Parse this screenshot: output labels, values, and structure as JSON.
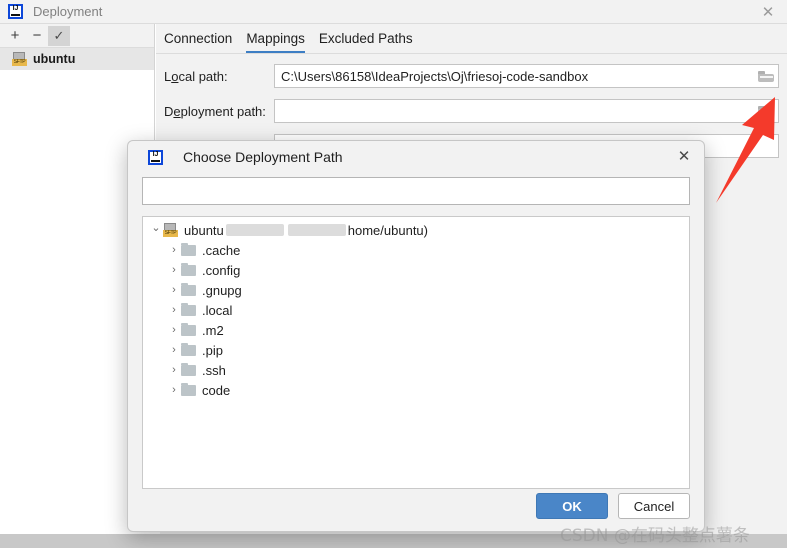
{
  "window": {
    "title": "Deployment",
    "logo_icon": "intellij-idea-icon",
    "close_icon": "close-icon"
  },
  "sidebar": {
    "toolbar": [
      {
        "name": "add",
        "glyph": "+",
        "checked": false
      },
      {
        "name": "remove",
        "glyph": "−",
        "checked": false
      },
      {
        "name": "set-default",
        "glyph": "✓",
        "checked": true
      }
    ],
    "servers": [
      {
        "label": "ubuntu",
        "icon": "sftp-server-icon",
        "badge": "SFTP",
        "selected": true
      }
    ]
  },
  "tabs": [
    {
      "label": "Connection",
      "active": false
    },
    {
      "label": "Mappings",
      "active": true
    },
    {
      "label": "Excluded Paths",
      "active": false
    }
  ],
  "fields": {
    "local_path": {
      "label_pre": "L",
      "label_mnemonic": "o",
      "label_post": "cal path:",
      "label": "Local path:",
      "value": "C:\\Users\\86158\\IdeaProjects\\Oj\\friesoj-code-sandbox",
      "browse_icon": "folder-browse-icon"
    },
    "deployment_path": {
      "label_pre": "D",
      "label_mnemonic": "e",
      "label_post": "ployment path:",
      "label": "Deployment path:",
      "value": "",
      "browse_icon": "folder-browse-icon"
    }
  },
  "background_hint": "u),",
  "dialog": {
    "logo_icon": "intellij-idea-icon",
    "title": "Choose Deployment Path",
    "close_icon": "close-icon",
    "search_value": "",
    "tree": {
      "root": {
        "label": "ubuntu",
        "icon": "sftp-server-icon",
        "badge": "SFTP",
        "redacted": true,
        "suffix": "home/ubuntu)",
        "expanded": true
      },
      "children": [
        {
          "label": ".cache",
          "icon": "folder-icon",
          "expanded": false
        },
        {
          "label": ".config",
          "icon": "folder-icon",
          "expanded": false
        },
        {
          "label": ".gnupg",
          "icon": "folder-icon",
          "expanded": false
        },
        {
          "label": ".local",
          "icon": "folder-icon",
          "expanded": false
        },
        {
          "label": ".m2",
          "icon": "folder-icon",
          "expanded": false
        },
        {
          "label": ".pip",
          "icon": "folder-icon",
          "expanded": false
        },
        {
          "label": ".ssh",
          "icon": "folder-icon",
          "expanded": false
        },
        {
          "label": "code",
          "icon": "folder-icon",
          "expanded": false
        }
      ]
    },
    "buttons": {
      "ok": "OK",
      "cancel": "Cancel"
    }
  },
  "annotation": {
    "arrow_icon": "red-arrow-annotation",
    "color": "#f43a2b"
  },
  "watermark": "CSDN @在码头整点薯条",
  "colors": {
    "accent_blue": "#3d7ec4",
    "primary_button": "#4a86c8",
    "panel_bg": "#f2f2f2",
    "selection_bg": "#e6e6e6",
    "annotation_red": "#f43a2b"
  }
}
